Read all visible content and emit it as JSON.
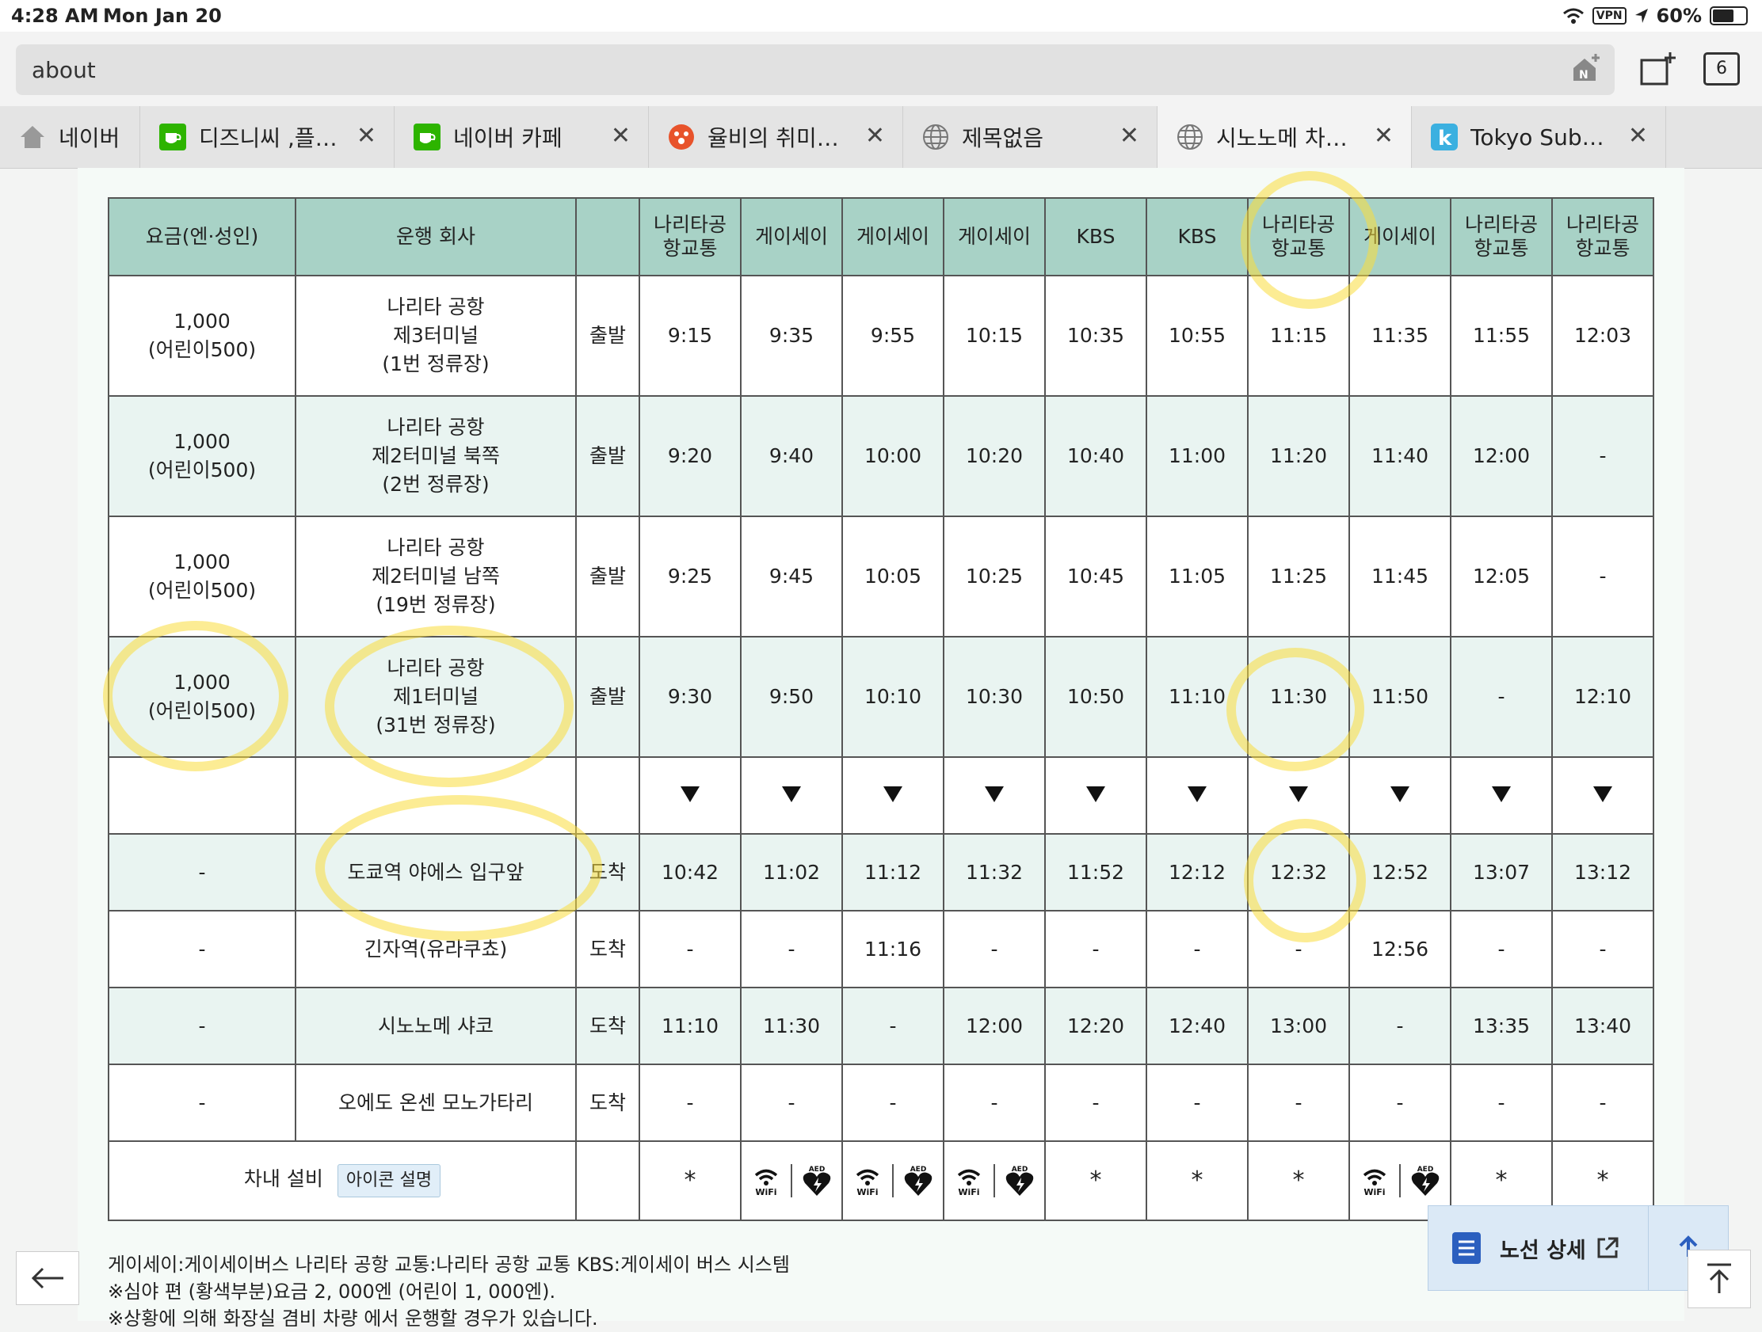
{
  "status": {
    "time": "4:28 AM",
    "date": "Mon Jan 20",
    "vpn": "VPN",
    "battery": "60%"
  },
  "browser": {
    "url": "about",
    "tab_count": "6",
    "tabs": [
      {
        "label": "네이버",
        "icon": "home-icon"
      },
      {
        "label": "디즈니씨 ,플…",
        "icon": "cafe-icon"
      },
      {
        "label": "네이버 카페",
        "icon": "cafe-icon"
      },
      {
        "label": "율비의 취미…",
        "icon": "blog-icon"
      },
      {
        "label": "제목없음",
        "icon": "globe-icon"
      },
      {
        "label": "시노노메 차…",
        "icon": "globe-icon"
      },
      {
        "label": "Tokyo Sub…",
        "icon": "k-app-icon"
      }
    ]
  },
  "timetable": {
    "header": {
      "fare": "요금(엔·성인)",
      "company": "운행 회사",
      "type": "",
      "operators": [
        "나리타공항교통",
        "게이세이",
        "게이세이",
        "게이세이",
        "KBS",
        "KBS",
        "나리타공항교통",
        "게이세이",
        "나리타공항교통",
        "나리타공항교통"
      ]
    },
    "rows": [
      {
        "fare": "1,000\n(어린이500)",
        "stop": "나리타 공항\n제3터미널\n(1번 정류장)",
        "type": "출발",
        "times": [
          "9:15",
          "9:35",
          "9:55",
          "10:15",
          "10:35",
          "10:55",
          "11:15",
          "11:35",
          "11:55",
          "12:03"
        ]
      },
      {
        "fare": "1,000\n(어린이500)",
        "stop": "나리타 공항\n제2터미널 북쪽\n(2번 정류장)",
        "type": "출발",
        "times": [
          "9:20",
          "9:40",
          "10:00",
          "10:20",
          "10:40",
          "11:00",
          "11:20",
          "11:40",
          "12:00",
          "-"
        ]
      },
      {
        "fare": "1,000\n(어린이500)",
        "stop": "나리타 공항\n제2터미널 남쪽\n(19번 정류장)",
        "type": "출발",
        "times": [
          "9:25",
          "9:45",
          "10:05",
          "10:25",
          "10:45",
          "11:05",
          "11:25",
          "11:45",
          "12:05",
          "-"
        ]
      },
      {
        "fare": "1,000\n(어린이500)",
        "stop": "나리타 공항\n제1터미널\n(31번 정류장)",
        "type": "출발",
        "times": [
          "9:30",
          "9:50",
          "10:10",
          "10:30",
          "10:50",
          "11:10",
          "11:30",
          "11:50",
          "-",
          "12:10"
        ]
      }
    ],
    "arrivals": [
      {
        "fare": "-",
        "stop": "도쿄역 야에스 입구앞",
        "type": "도착",
        "times": [
          "10:42",
          "11:02",
          "11:12",
          "11:32",
          "11:52",
          "12:12",
          "12:32",
          "12:52",
          "13:07",
          "13:12"
        ]
      },
      {
        "fare": "-",
        "stop": "긴자역(유라쿠쵸)",
        "type": "도착",
        "times": [
          "-",
          "-",
          "11:16",
          "-",
          "-",
          "-",
          "-",
          "12:56",
          "-",
          "-"
        ]
      },
      {
        "fare": "-",
        "stop": "시노노메 샤코",
        "type": "도착",
        "times": [
          "11:10",
          "11:30",
          "-",
          "12:00",
          "12:20",
          "12:40",
          "13:00",
          "-",
          "13:35",
          "13:40"
        ]
      },
      {
        "fare": "-",
        "stop": "오에도 온센 모노가타리",
        "type": "도착",
        "times": [
          "-",
          "-",
          "-",
          "-",
          "-",
          "-",
          "-",
          "-",
          "-",
          "-"
        ]
      }
    ],
    "facility_label": "차내 설비",
    "icon_help": "아이콘 설명",
    "facilities": [
      "*",
      "wifi+aed",
      "wifi+aed",
      "wifi+aed",
      "*",
      "*",
      "*",
      "wifi+aed",
      "*",
      "*"
    ],
    "wifi_text": "WiFi",
    "aed_text": "AED"
  },
  "notes": [
    "게이세이:게이세이버스 나리타 공항 교통:나리타 공항 교통 KBS:게이세이 버스 시스템",
    "※심야 편 (황색부분)요금 2, 000엔 (어린이 1, 000엔).",
    "※상황에 의해 화장실 겸비 차량 에서 운행할 경우가 있습니다."
  ],
  "route_detail": "노선 상세",
  "colors": {
    "header_bg": "#a8d2c6",
    "alt_row": "#e9f4f1",
    "highlight": "#fadc3c"
  }
}
